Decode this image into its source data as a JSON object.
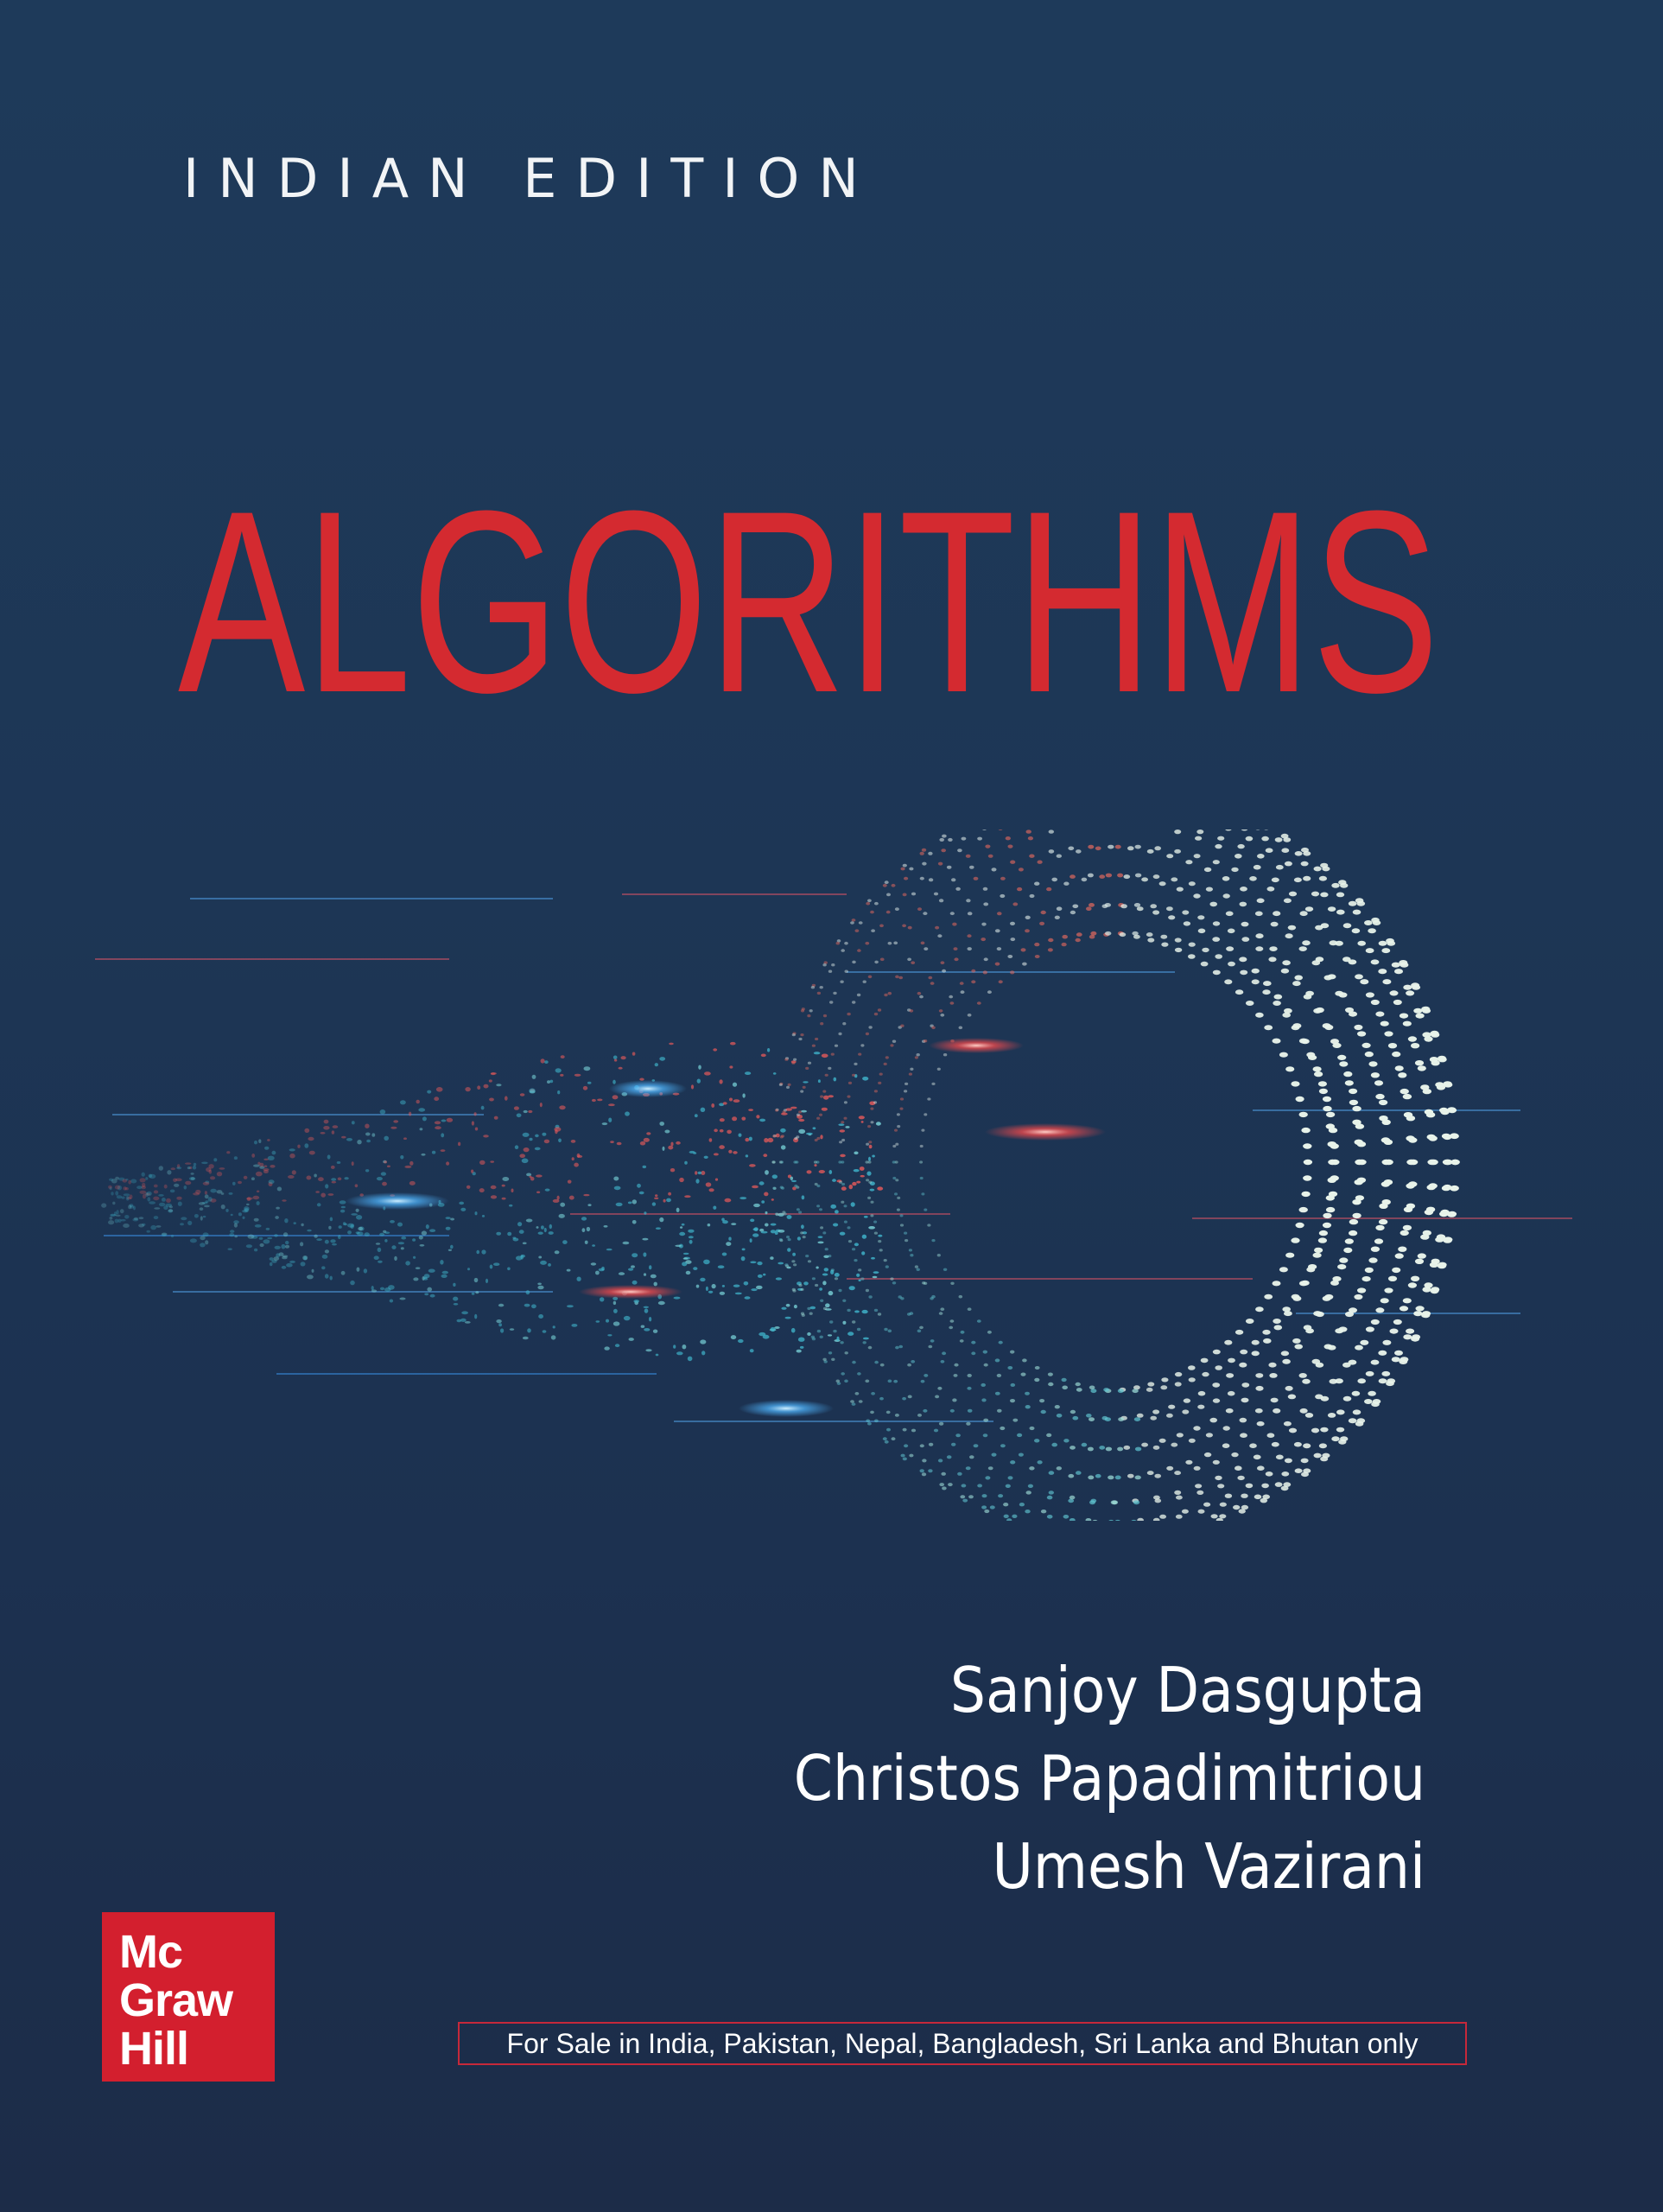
{
  "cover": {
    "edition": "INDIAN EDITION",
    "title": "ALGORITHMS",
    "authors": [
      "Sanjoy Dasgupta",
      "Christos Papadimitriou",
      "Umesh Vazirani"
    ],
    "publisher_logo": {
      "line1": "Mc",
      "line2": "Graw",
      "line3": "Hill"
    },
    "sale_notice": "For Sale in India, Pakistan, Nepal, Bangladesh, Sri Lanka and Bhutan only"
  },
  "colors": {
    "background": "#1d3655",
    "title": "#d42a30",
    "logo": "#d31f2e",
    "text": "#ffffff"
  },
  "icons": [
    "torus-dot-illustration",
    "mcgraw-hill-logo"
  ]
}
